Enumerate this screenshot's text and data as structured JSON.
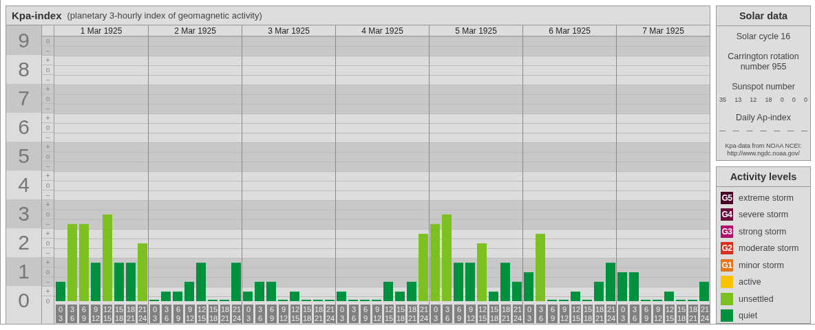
{
  "header": {
    "title": "Kpa-index",
    "subtitle": "(planetary 3-hourly index of geomagnetic activity)"
  },
  "kp_chart": {
    "days": [
      "1 Mar 1925",
      "2 Mar 1925",
      "3 Mar 1925",
      "4 Mar 1925",
      "5 Mar 1925",
      "6 Mar 1925",
      "7 Mar 1925"
    ],
    "minor_ticks": [
      "o",
      "–",
      "+",
      "o",
      "–",
      "+",
      "o",
      "–",
      "+",
      "o",
      "–",
      "+",
      "o",
      "–",
      "+",
      "o",
      "–",
      "+",
      "o",
      "–",
      "+",
      "o",
      "–",
      "+",
      "o",
      "–",
      "+",
      "o"
    ],
    "chart_data": {
      "type": "bar",
      "stacked": true,
      "grid": true,
      "ylim": [
        0,
        9
      ],
      "yticks": [
        {
          "value": 9,
          "label": "9"
        },
        {
          "value": 8,
          "label": "8"
        },
        {
          "value": 7,
          "label": "7"
        },
        {
          "value": 6,
          "label": "6"
        },
        {
          "value": 5,
          "label": "5"
        },
        {
          "value": 4,
          "label": "4"
        },
        {
          "value": 3,
          "label": "3"
        },
        {
          "value": 2,
          "label": "2"
        },
        {
          "value": 1,
          "label": "1"
        },
        {
          "value": 0,
          "label": "0"
        }
      ],
      "categories": [
        "0 3",
        "3 6",
        "6 9",
        "9 12",
        "12 15",
        "15 18",
        "18 21",
        "21 24",
        "0 3",
        "3 6",
        "6 9",
        "9 12",
        "12 15",
        "15 18",
        "18 21",
        "21 24",
        "0 3",
        "3 6",
        "6 9",
        "9 12",
        "12 15",
        "15 18",
        "18 21",
        "21 24",
        "0 3",
        "3 6",
        "6 9",
        "9 12",
        "12 15",
        "15 18",
        "18 21",
        "21 24",
        "0 3",
        "3 6",
        "6 9",
        "9 12",
        "12 15",
        "15 18",
        "18 21",
        "21 24",
        "0 3",
        "3 6",
        "6 9",
        "9 12",
        "12 15",
        "15 18",
        "18 21",
        "21 24",
        "0 3",
        "3 6",
        "6 9",
        "9 12",
        "12 15",
        "15 18",
        "18 21",
        "21 24"
      ],
      "series": [
        {
          "color": "#00913f",
          "values": [
            0.67,
            null,
            null,
            1.33,
            null,
            1.33,
            1.33,
            null,
            0,
            0.33,
            0.33,
            0.67,
            1.33,
            0,
            0,
            1.33,
            0.33,
            0.67,
            0.67,
            0,
            0.33,
            0,
            0,
            0,
            0.33,
            0,
            0,
            0,
            0.67,
            0.33,
            0.67,
            null,
            null,
            null,
            1.33,
            1.33,
            null,
            0.33,
            1.33,
            0.67,
            1,
            null,
            0,
            0,
            0.33,
            0,
            0.67,
            1.33,
            1,
            1,
            0,
            0,
            0.33,
            0,
            0,
            0.67
          ]
        },
        {
          "color": "#7cc121",
          "values": [
            null,
            2.67,
            2.67,
            null,
            3,
            null,
            null,
            2,
            null,
            null,
            null,
            null,
            null,
            null,
            null,
            null,
            null,
            null,
            null,
            null,
            null,
            null,
            null,
            null,
            null,
            null,
            null,
            null,
            null,
            null,
            null,
            2.33,
            2.67,
            3,
            null,
            null,
            2,
            null,
            null,
            null,
            null,
            2.33,
            null,
            null,
            null,
            null,
            null,
            null,
            null,
            null,
            null,
            null,
            null,
            null,
            null,
            null
          ]
        }
      ]
    }
  },
  "solar_data": {
    "title": "Solar data",
    "solar_cycle": "Solar cycle 16",
    "carrington": "Carrington rotation number 955",
    "sunspot_label": "Sunspot number",
    "sunspot_values": [
      "35",
      "13",
      "12",
      "18",
      "0",
      "0",
      "0"
    ],
    "ap_label": "Daily Ap-index",
    "ap_values": [
      "—",
      "—",
      "—",
      "—",
      "—",
      "—",
      "—"
    ],
    "source": "Kpa-data from NOAA NCEI:",
    "source_url": "http://www.ngdc.noaa.gov/"
  },
  "activity_levels": {
    "title": "Activity levels",
    "items": [
      {
        "badge": "G5",
        "label": "extreme storm",
        "color": "#4a0027"
      },
      {
        "badge": "G4",
        "label": "severe storm",
        "color": "#6c0a3d"
      },
      {
        "badge": "G3",
        "label": "strong storm",
        "color": "#b01169"
      },
      {
        "badge": "G2",
        "label": "moderate storm",
        "color": "#d8301e"
      },
      {
        "badge": "G1",
        "label": "minor storm",
        "color": "#e67519"
      },
      {
        "label": "active",
        "color": "#f9c300"
      },
      {
        "label": "unsettled",
        "color": "#7cc121"
      },
      {
        "label": "quiet",
        "color": "#00913f"
      }
    ]
  }
}
